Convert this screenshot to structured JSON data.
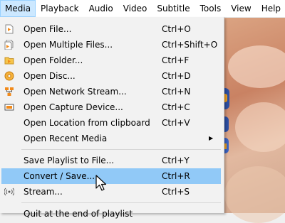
{
  "menubar": {
    "items": [
      "Media",
      "Playback",
      "Audio",
      "Video",
      "Subtitle",
      "Tools",
      "View",
      "Help"
    ]
  },
  "media_menu": {
    "items": [
      {
        "label": "Open File...",
        "shortcut": "Ctrl+O",
        "icon": "file-icon"
      },
      {
        "label": "Open Multiple Files...",
        "shortcut": "Ctrl+Shift+O",
        "icon": "multiple-files-icon"
      },
      {
        "label": "Open Folder...",
        "shortcut": "Ctrl+F",
        "icon": "folder-icon"
      },
      {
        "label": "Open Disc...",
        "shortcut": "Ctrl+D",
        "icon": "disc-icon"
      },
      {
        "label": "Open Network Stream...",
        "shortcut": "Ctrl+N",
        "icon": "network-icon"
      },
      {
        "label": "Open Capture Device...",
        "shortcut": "Ctrl+C",
        "icon": "capture-device-icon"
      },
      {
        "label": "Open Location from clipboard",
        "shortcut": "Ctrl+V",
        "icon": ""
      },
      {
        "label": "Open Recent Media",
        "shortcut": "",
        "submenu": true,
        "icon": ""
      },
      {
        "label": "Save Playlist to File...",
        "shortcut": "Ctrl+Y",
        "icon": ""
      },
      {
        "label": "Convert / Save...",
        "shortcut": "Ctrl+R",
        "icon": "",
        "highlighted": true
      },
      {
        "label": "Stream...",
        "shortcut": "Ctrl+S",
        "icon": "stream-icon"
      },
      {
        "label": "Quit at the end of playlist",
        "shortcut": "",
        "icon": ""
      }
    ],
    "submenu_arrow": "▶"
  },
  "colors": {
    "highlight": "#91c9f7",
    "active_menu": "#cce8ff",
    "icon_orange": "#f28a1a"
  }
}
